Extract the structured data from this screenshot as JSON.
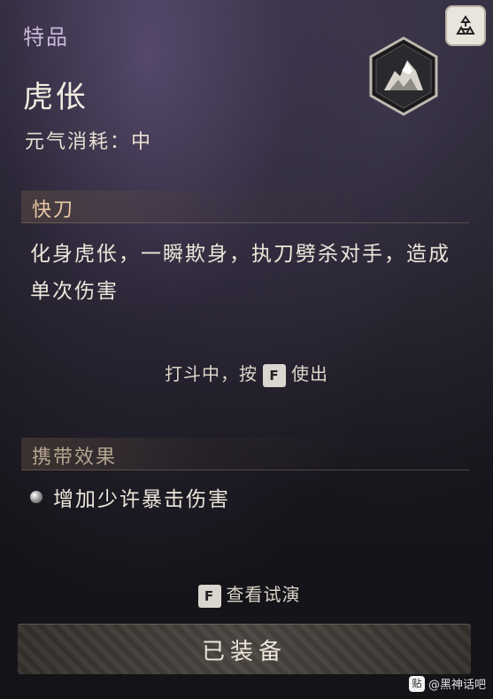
{
  "header": {
    "quality_label": "特品",
    "skill_name": "虎伥",
    "cost_text": "元气消耗：中"
  },
  "icons": {
    "corner_badge": "mountain-emblem-icon",
    "skill_icon": "tiger-skill-icon",
    "bullet": "pearl-bullet-icon"
  },
  "section_quick": {
    "title": "快刀",
    "description": "化身虎伥，一瞬欺身，执刀劈杀对手，造成单次伤害",
    "hint_before": "打斗中，按",
    "hint_key": "F",
    "hint_after": "使出"
  },
  "section_carry": {
    "title": "携带效果",
    "effect": "增加少许暴击伤害"
  },
  "footer": {
    "preview_key": "F",
    "preview_label": "查看试演",
    "equip_label": "已装备"
  },
  "watermark": {
    "logo_text": "贴",
    "text": "@黑神话吧"
  },
  "colors": {
    "quality": "#c9b6d8",
    "section_title": "#e9c9a4",
    "carry_title": "#b4a58f",
    "text": "#ece6da"
  }
}
